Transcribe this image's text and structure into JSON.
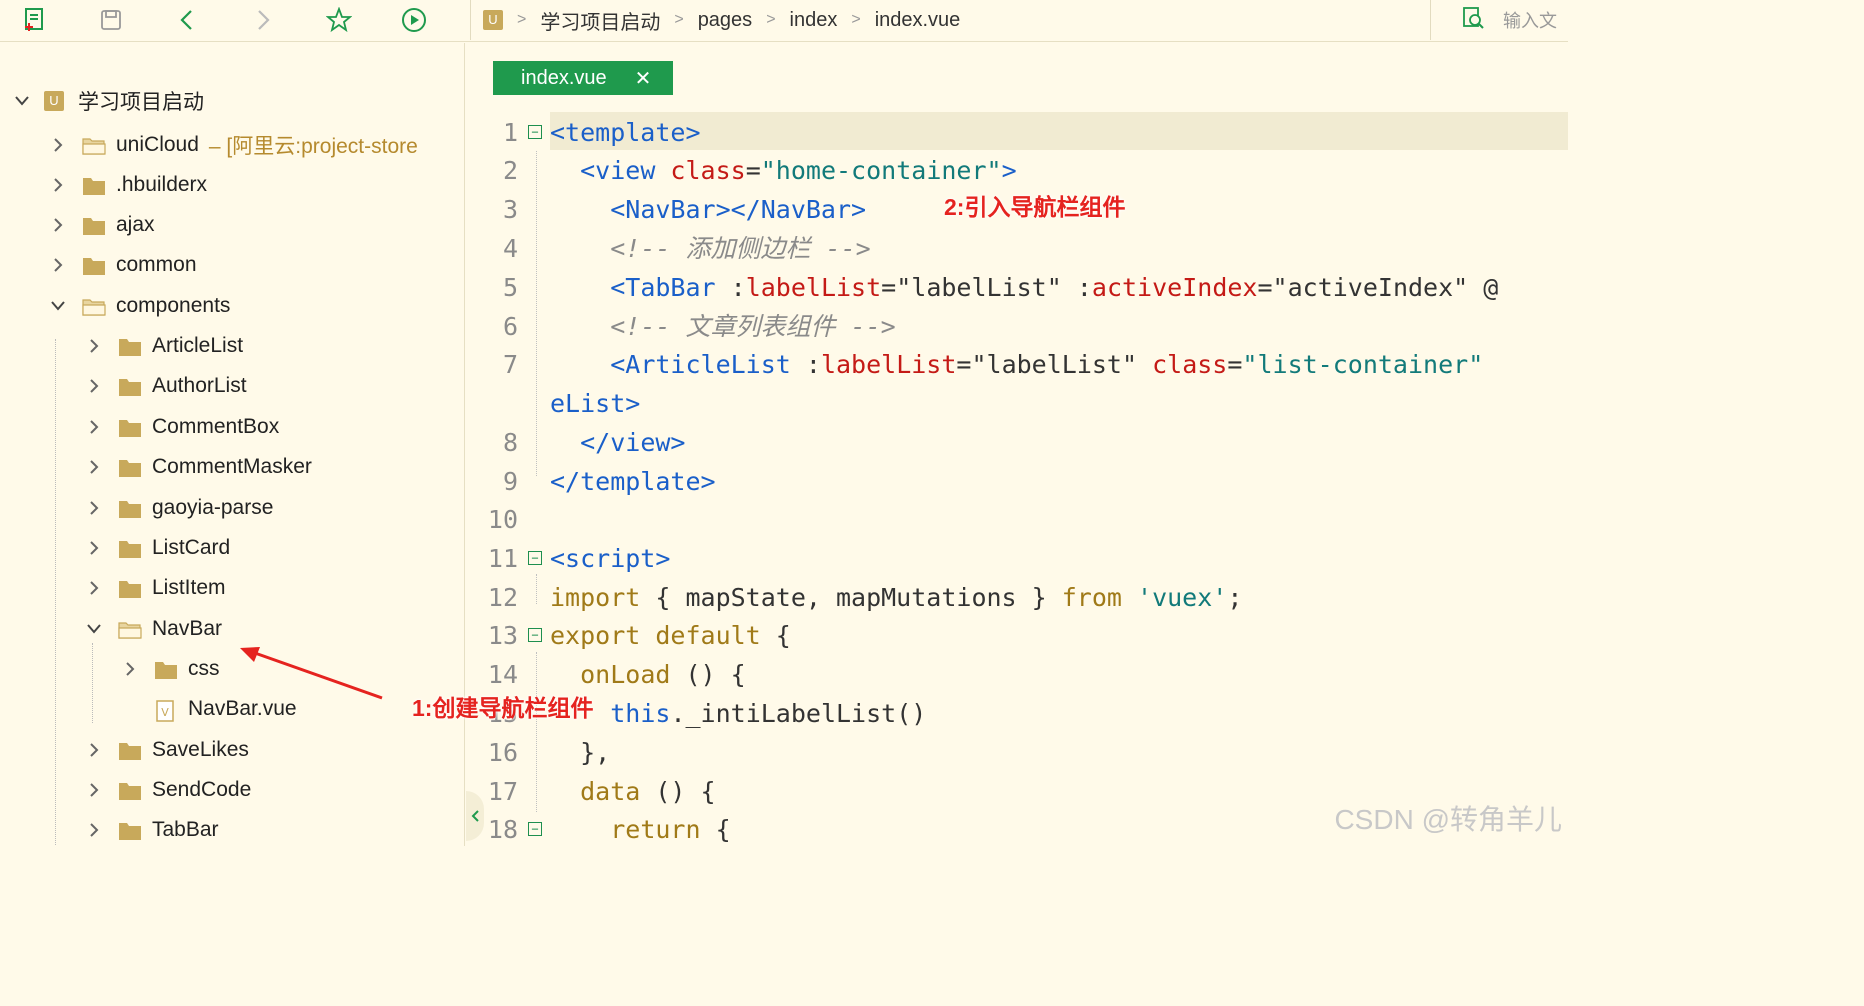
{
  "breadcrumb": [
    "学习项目启动",
    "pages",
    "index",
    "index.vue"
  ],
  "search_placeholder": "输入文",
  "sidebar": {
    "project": "学习项目启动",
    "items": [
      {
        "label": "uniCloud",
        "suffix": "– [阿里云:project-store"
      },
      {
        "label": ".hbuilderx"
      },
      {
        "label": "ajax"
      },
      {
        "label": "common"
      },
      {
        "label": "components"
      },
      {
        "label": "ArticleList"
      },
      {
        "label": "AuthorList"
      },
      {
        "label": "CommentBox"
      },
      {
        "label": "CommentMasker"
      },
      {
        "label": "gaoyia-parse"
      },
      {
        "label": "ListCard"
      },
      {
        "label": "ListItem"
      },
      {
        "label": "NavBar"
      },
      {
        "label": "css"
      },
      {
        "label": "NavBar.vue"
      },
      {
        "label": "SaveLikes"
      },
      {
        "label": "SendCode"
      },
      {
        "label": "TabBar"
      }
    ]
  },
  "editor": {
    "tab_label": "index.vue",
    "line_numbers": [
      "1",
      "2",
      "3",
      "4",
      "5",
      "6",
      "7",
      "",
      "8",
      "9",
      "10",
      "11",
      "12",
      "13",
      "14",
      "15",
      "16",
      "17",
      "18"
    ]
  },
  "code": {
    "l1": "<template>",
    "l2_open": "<view ",
    "l2_attr": "class",
    "l2_eq": "=",
    "l2_str": "\"home-container\"",
    "l2_close": ">",
    "l3": "<NavBar></NavBar>",
    "l4": "<!-- 添加侧边栏 -->",
    "l5_tag": "<TabBar ",
    "l5_c1": ":",
    "l5_attr1": "labelList",
    "l5_v1": "=\"labelList\" ",
    "l5_c2": ":",
    "l5_attr2": "activeIndex",
    "l5_v2": "=\"activeIndex\" @",
    "l6": "<!-- 文章列表组件 -->",
    "l7_tag": "<ArticleList ",
    "l7_c1": ":",
    "l7_attr1": "labelList",
    "l7_v1": "=\"labelList\" ",
    "l7_attr2": "class",
    "l7_eq": "=",
    "l7_str": "\"list-container\"",
    "l7b": "eList>",
    "l8": "</view>",
    "l9": "</template>",
    "l11": "<script>",
    "l12_kw1": "import",
    "l12_mid": " { mapState, mapMutations } ",
    "l12_kw2": "from",
    "l12_str": " 'vuex'",
    "l12_end": ";",
    "l13_kw": "export default",
    "l13_end": " {",
    "l14_kw": "onLoad",
    "l14_end": " () {",
    "l15_this": "this",
    "l15_end": "._intiLabelList()",
    "l16": "},",
    "l17_kw": "data",
    "l17_end": " () {",
    "l18_kw": "return",
    "l18_end": " {"
  },
  "annotations": {
    "step1": "1:创建导航栏组件",
    "step2": "2:引入导航栏组件"
  },
  "watermark": "CSDN @转角羊儿",
  "colors": {
    "accent": "#1f9a4d",
    "annotation": "#e5231f",
    "folder": "#c8a95b"
  }
}
